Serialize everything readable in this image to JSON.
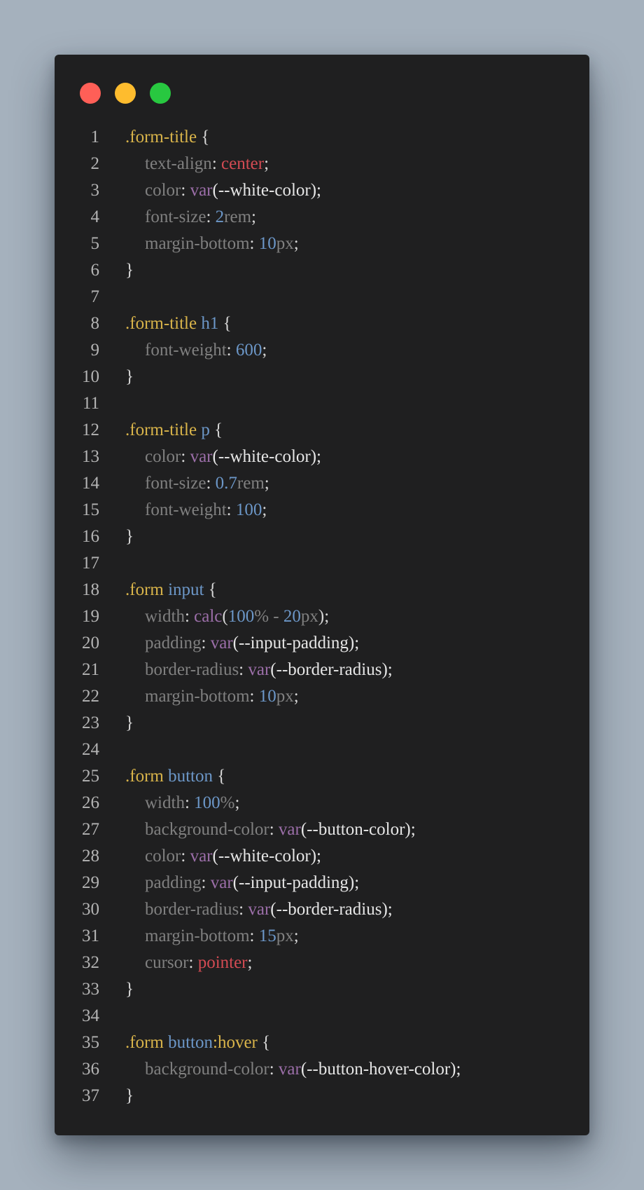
{
  "window": {
    "colors": {
      "close": "#ff5f57",
      "minimize": "#febc2e",
      "maximize": "#28c840",
      "background": "#1f1f20"
    }
  },
  "code": {
    "lines": [
      {
        "n": "1",
        "tokens": [
          {
            "t": ".form-title",
            "c": "sel"
          },
          {
            "t": " {",
            "c": "punc"
          }
        ]
      },
      {
        "n": "2",
        "indent": true,
        "tokens": [
          {
            "t": "text-align",
            "c": "prop"
          },
          {
            "t": ": ",
            "c": "punc"
          },
          {
            "t": "center",
            "c": "kw"
          },
          {
            "t": ";",
            "c": "punc"
          }
        ]
      },
      {
        "n": "3",
        "indent": true,
        "tokens": [
          {
            "t": "color",
            "c": "prop"
          },
          {
            "t": ": ",
            "c": "punc"
          },
          {
            "t": "var",
            "c": "fn"
          },
          {
            "t": "(--white-color);",
            "c": "var"
          }
        ]
      },
      {
        "n": "4",
        "indent": true,
        "tokens": [
          {
            "t": "font-size",
            "c": "prop"
          },
          {
            "t": ": ",
            "c": "punc"
          },
          {
            "t": "2",
            "c": "num"
          },
          {
            "t": "rem",
            "c": "unit"
          },
          {
            "t": ";",
            "c": "punc"
          }
        ]
      },
      {
        "n": "5",
        "indent": true,
        "tokens": [
          {
            "t": "margin-bottom",
            "c": "prop"
          },
          {
            "t": ": ",
            "c": "punc"
          },
          {
            "t": "10",
            "c": "num"
          },
          {
            "t": "px",
            "c": "unit"
          },
          {
            "t": ";",
            "c": "punc"
          }
        ]
      },
      {
        "n": "6",
        "tokens": [
          {
            "t": "}",
            "c": "punc"
          }
        ]
      },
      {
        "n": "7",
        "tokens": []
      },
      {
        "n": "8",
        "tokens": [
          {
            "t": ".form-title",
            "c": "sel"
          },
          {
            "t": " ",
            "c": "punc"
          },
          {
            "t": "h1",
            "c": "tag"
          },
          {
            "t": " {",
            "c": "punc"
          }
        ]
      },
      {
        "n": "9",
        "indent": true,
        "tokens": [
          {
            "t": "font-weight",
            "c": "prop"
          },
          {
            "t": ": ",
            "c": "punc"
          },
          {
            "t": "600",
            "c": "num"
          },
          {
            "t": ";",
            "c": "punc"
          }
        ]
      },
      {
        "n": "10",
        "tokens": [
          {
            "t": "}",
            "c": "punc"
          }
        ]
      },
      {
        "n": "11",
        "tokens": []
      },
      {
        "n": "12",
        "tokens": [
          {
            "t": ".form-title",
            "c": "sel"
          },
          {
            "t": " ",
            "c": "punc"
          },
          {
            "t": "p",
            "c": "tag"
          },
          {
            "t": " {",
            "c": "punc"
          }
        ]
      },
      {
        "n": "13",
        "indent": true,
        "tokens": [
          {
            "t": "color",
            "c": "prop"
          },
          {
            "t": ": ",
            "c": "punc"
          },
          {
            "t": "var",
            "c": "fn"
          },
          {
            "t": "(--white-color);",
            "c": "var"
          }
        ]
      },
      {
        "n": "14",
        "indent": true,
        "tokens": [
          {
            "t": "font-size",
            "c": "prop"
          },
          {
            "t": ": ",
            "c": "punc"
          },
          {
            "t": "0.7",
            "c": "num"
          },
          {
            "t": "rem",
            "c": "unit"
          },
          {
            "t": ";",
            "c": "punc"
          }
        ]
      },
      {
        "n": "15",
        "indent": true,
        "tokens": [
          {
            "t": "font-weight",
            "c": "prop"
          },
          {
            "t": ": ",
            "c": "punc"
          },
          {
            "t": "100",
            "c": "num"
          },
          {
            "t": ";",
            "c": "punc"
          }
        ]
      },
      {
        "n": "16",
        "tokens": [
          {
            "t": "}",
            "c": "punc"
          }
        ]
      },
      {
        "n": "17",
        "tokens": []
      },
      {
        "n": "18",
        "tokens": [
          {
            "t": ".form",
            "c": "sel"
          },
          {
            "t": " ",
            "c": "punc"
          },
          {
            "t": "input",
            "c": "tag"
          },
          {
            "t": " {",
            "c": "punc"
          }
        ]
      },
      {
        "n": "19",
        "indent": true,
        "tokens": [
          {
            "t": "width",
            "c": "prop"
          },
          {
            "t": ": ",
            "c": "punc"
          },
          {
            "t": "calc",
            "c": "fn"
          },
          {
            "t": "(",
            "c": "punc"
          },
          {
            "t": "100",
            "c": "num"
          },
          {
            "t": "% - ",
            "c": "unit"
          },
          {
            "t": "20",
            "c": "num"
          },
          {
            "t": "px",
            "c": "unit"
          },
          {
            "t": ");",
            "c": "punc"
          }
        ]
      },
      {
        "n": "20",
        "indent": true,
        "tokens": [
          {
            "t": "padding",
            "c": "prop"
          },
          {
            "t": ": ",
            "c": "punc"
          },
          {
            "t": "var",
            "c": "fn"
          },
          {
            "t": "(--input-padding);",
            "c": "var"
          }
        ]
      },
      {
        "n": "21",
        "indent": true,
        "tokens": [
          {
            "t": "border-radius",
            "c": "prop"
          },
          {
            "t": ": ",
            "c": "punc"
          },
          {
            "t": "var",
            "c": "fn"
          },
          {
            "t": "(--border-radius);",
            "c": "var"
          }
        ]
      },
      {
        "n": "22",
        "indent": true,
        "tokens": [
          {
            "t": "margin-bottom",
            "c": "prop"
          },
          {
            "t": ": ",
            "c": "punc"
          },
          {
            "t": "10",
            "c": "num"
          },
          {
            "t": "px",
            "c": "unit"
          },
          {
            "t": ";",
            "c": "punc"
          }
        ]
      },
      {
        "n": "23",
        "tokens": [
          {
            "t": "}",
            "c": "punc"
          }
        ]
      },
      {
        "n": "24",
        "tokens": []
      },
      {
        "n": "25",
        "tokens": [
          {
            "t": ".form",
            "c": "sel"
          },
          {
            "t": " ",
            "c": "punc"
          },
          {
            "t": "button",
            "c": "tag"
          },
          {
            "t": " {",
            "c": "punc"
          }
        ]
      },
      {
        "n": "26",
        "indent": true,
        "tokens": [
          {
            "t": "width",
            "c": "prop"
          },
          {
            "t": ": ",
            "c": "punc"
          },
          {
            "t": "100",
            "c": "num"
          },
          {
            "t": "%",
            "c": "unit"
          },
          {
            "t": ";",
            "c": "punc"
          }
        ]
      },
      {
        "n": "27",
        "indent": true,
        "tokens": [
          {
            "t": "background-color",
            "c": "prop"
          },
          {
            "t": ": ",
            "c": "punc"
          },
          {
            "t": "var",
            "c": "fn"
          },
          {
            "t": "(--button-color);",
            "c": "var"
          }
        ]
      },
      {
        "n": "28",
        "indent": true,
        "tokens": [
          {
            "t": "color",
            "c": "prop"
          },
          {
            "t": ": ",
            "c": "punc"
          },
          {
            "t": "var",
            "c": "fn"
          },
          {
            "t": "(--white-color);",
            "c": "var"
          }
        ]
      },
      {
        "n": "29",
        "indent": true,
        "tokens": [
          {
            "t": "padding",
            "c": "prop"
          },
          {
            "t": ": ",
            "c": "punc"
          },
          {
            "t": "var",
            "c": "fn"
          },
          {
            "t": "(--input-padding);",
            "c": "var"
          }
        ]
      },
      {
        "n": "30",
        "indent": true,
        "tokens": [
          {
            "t": "border-radius",
            "c": "prop"
          },
          {
            "t": ": ",
            "c": "punc"
          },
          {
            "t": "var",
            "c": "fn"
          },
          {
            "t": "(--border-radius);",
            "c": "var"
          }
        ]
      },
      {
        "n": "31",
        "indent": true,
        "tokens": [
          {
            "t": "margin-bottom",
            "c": "prop"
          },
          {
            "t": ": ",
            "c": "punc"
          },
          {
            "t": "15",
            "c": "num"
          },
          {
            "t": "px",
            "c": "unit"
          },
          {
            "t": ";",
            "c": "punc"
          }
        ]
      },
      {
        "n": "32",
        "indent": true,
        "tokens": [
          {
            "t": "cursor",
            "c": "prop"
          },
          {
            "t": ": ",
            "c": "punc"
          },
          {
            "t": "pointer",
            "c": "kw"
          },
          {
            "t": ";",
            "c": "punc"
          }
        ]
      },
      {
        "n": "33",
        "tokens": [
          {
            "t": "}",
            "c": "punc"
          }
        ]
      },
      {
        "n": "34",
        "tokens": []
      },
      {
        "n": "35",
        "tokens": [
          {
            "t": ".form",
            "c": "sel"
          },
          {
            "t": " ",
            "c": "punc"
          },
          {
            "t": "button",
            "c": "tag"
          },
          {
            "t": ":hover",
            "c": "sel"
          },
          {
            "t": " {",
            "c": "punc"
          }
        ]
      },
      {
        "n": "36",
        "indent": true,
        "tokens": [
          {
            "t": "background-color",
            "c": "prop"
          },
          {
            "t": ": ",
            "c": "punc"
          },
          {
            "t": "var",
            "c": "fn"
          },
          {
            "t": "(--button-hover-color);",
            "c": "var"
          }
        ]
      },
      {
        "n": "37",
        "tokens": [
          {
            "t": "}",
            "c": "punc"
          }
        ]
      }
    ]
  }
}
